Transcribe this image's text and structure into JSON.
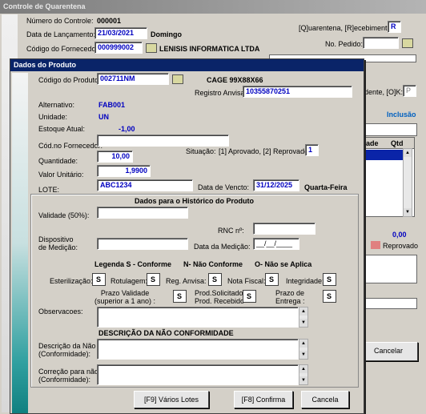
{
  "back": {
    "title": "Controle de Quarentena",
    "numero_label": "Número do Controle:",
    "numero_value": "000001",
    "lanc_label": "Data de Lançamento:",
    "lanc_value": "21/03/2021",
    "lanc_day": "Domingo",
    "fornecedor_label": "Código do Fornecedor:",
    "fornecedor_value": "000999002",
    "fornecedor_name": "LENISIS INFORMATICA LTDA",
    "quarentena_label": "[Q]uarentena, [R]ecebimento :",
    "quarentena_value": "R",
    "pedido_label": "No. Pedido:",
    "dente_label": "dente, [O]K:",
    "dente_value": "P",
    "inclusao": "Inclusão",
    "grid_col1": "ade",
    "grid_col2": "Qtd",
    "total": "0,00",
    "reprovado": "Reprovado",
    "cancel_button": "Cancelar"
  },
  "dialog": {
    "title": "Dados do Produto",
    "codigo_label": "Código do Produto:",
    "codigo_value": "002711NM",
    "cage": "CAGE  99X88X66",
    "registro_label": "Registro Anvisa",
    "registro_value": "10355870251",
    "alternativo_label": "Alternativo:",
    "alternativo_value": "FAB001",
    "unidade_label": "Unidade:",
    "unidade_value": "UN",
    "estoque_label": "Estoque Atual:",
    "estoque_value": "-1,00",
    "cod_forn_label": "Cód.no Fornecedor:",
    "situacao_label": "Situação:",
    "situacao_hint": "[1] Aprovado, [2] Reprovado:",
    "situacao_value": "1",
    "quantidade_label": "Quantidade:",
    "quantidade_value": "10,00",
    "valor_label": "Valor Unitário:",
    "valor_value": "1,9900",
    "lote_label": "LOTE:",
    "lote_value": "ABC1234",
    "vencto_label": "Data de Vencto:",
    "vencto_value": "31/12/2025",
    "vencto_day": "Quarta-Feira",
    "hist_title": "Dados para o Histórico do Produto",
    "validade_label": "Validade (50%):",
    "rnc_label": "RNC nº:",
    "dispositivo_label": "Dispositivo\nde Medição:",
    "data_medicao_label": "Data da Medição:",
    "data_medicao_value": "__/__/____",
    "legenda": "Legenda S - Conforme      N- Não Conforme      O- Não se Aplica",
    "esterilizacao_label": "Esterilização:",
    "esterilizacao_value": "S",
    "rotulagem_label": "Rotulagem:",
    "rotulagem_value": "S",
    "reg_anvisa_label": "Reg. Anvisa:",
    "reg_anvisa_value": "S",
    "nota_fiscal_label": "Nota Fiscal:",
    "nota_fiscal_value": "S",
    "integridade_label": "Integridade:",
    "integridade_value": "S",
    "prazo_validade_label": "Prazo Validade\n(superior a 1 ano) :",
    "prazo_validade_value": "S",
    "prod_solicitado_label": "Prod.Solicitado x\nProd. Recebido",
    "prod_solicitado_value": "S",
    "prazo_entrega_label": "Prazo de\nEntrega :",
    "prazo_entrega_value": "S",
    "observacoes_label": "Observacoes:",
    "nc_title": "DESCRIÇÃO DA NÃO CONFORMIDADE",
    "descricao_label": "Descrição da Não\n(Conformidade):",
    "correcao_label": "Correção para não\n(Conformidade):",
    "btn_lotes": "[F9]   Vários Lotes",
    "btn_confirma": "[F8]   Confirma",
    "btn_cancela": "Cancela"
  }
}
